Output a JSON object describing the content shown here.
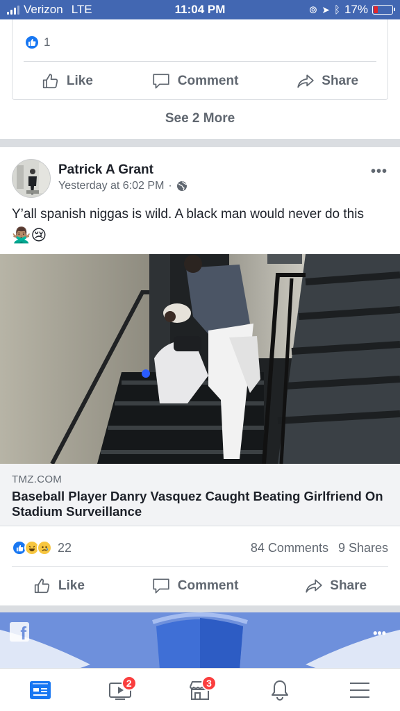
{
  "status_bar": {
    "carrier": "Verizon",
    "network": "LTE",
    "time": "11:04 PM",
    "battery": "17%",
    "battery_level": 0.17
  },
  "previous_post": {
    "reaction_count": "1",
    "actions": {
      "like": "Like",
      "comment": "Comment",
      "share": "Share"
    },
    "see_more": "See 2 More"
  },
  "post": {
    "author": "Patrick A Grant",
    "timestamp": "Yesterday at 6:02 PM",
    "separator": "·",
    "text": "Y’all spanish niggas is wild. A black man would never do this",
    "emoji": "🙅🏽‍♂️😢",
    "link": {
      "domain": "TMZ.COM",
      "title": "Baseball Player Danry Vasquez Caught Beating Girlfriend On Stadium Surveillance"
    },
    "stats": {
      "reactions": "22",
      "comments": "84 Comments",
      "shares": "9 Shares"
    },
    "actions": {
      "like": "Like",
      "comment": "Comment",
      "share": "Share"
    }
  },
  "tab_bar": {
    "tabs": [
      {
        "icon": "news-feed-icon",
        "badge": ""
      },
      {
        "icon": "watch-icon",
        "badge": "2"
      },
      {
        "icon": "marketplace-icon",
        "badge": "3"
      },
      {
        "icon": "notifications-bell-icon",
        "badge": ""
      },
      {
        "icon": "menu-icon",
        "badge": ""
      }
    ]
  },
  "colors": {
    "facebook_blue": "#4267b2",
    "like_blue": "#1877f2",
    "badge_red": "#fa3e3e",
    "text_gray": "#606770"
  }
}
